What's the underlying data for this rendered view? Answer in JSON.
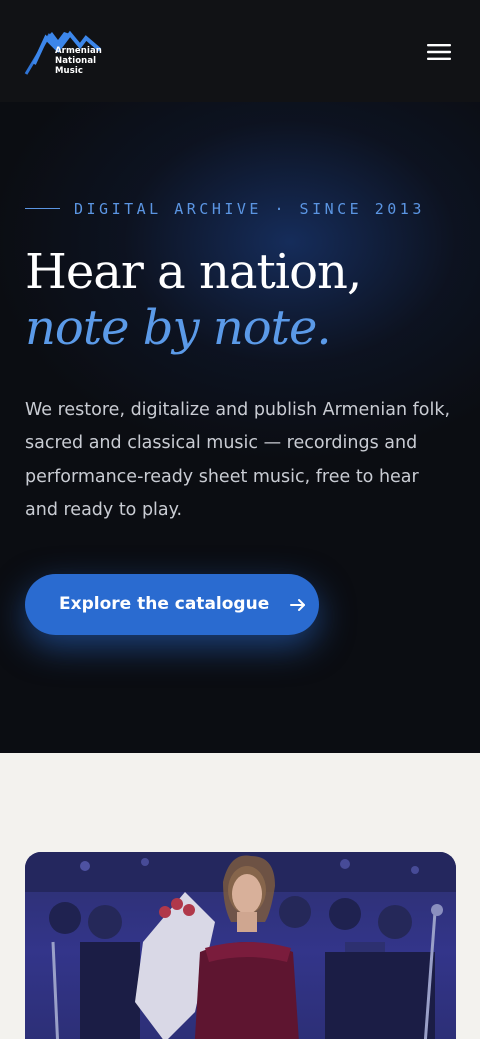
{
  "header": {
    "logo": {
      "line1": "Armenian",
      "line2": "National",
      "line3": "Music"
    },
    "menu_icon": "hamburger-menu-icon"
  },
  "hero": {
    "eyebrow": "DIGITAL ARCHIVE · SINCE 2013",
    "headline_line1": "Hear a nation,",
    "headline_line2": "note by note.",
    "intro": "We restore, digitalize and publish Armenian folk, sacred and classical music — recordings and performance-ready sheet music, free to hear and ready to play.",
    "cta_label": "Explore the catalogue",
    "cta_icon": "arrow-right-icon"
  },
  "colors": {
    "header_bg": "#111215",
    "hero_bg": "#0b0d12",
    "accent": "#5b95e2",
    "cta": "#2a6bd0",
    "light_bg": "#f3f2ee"
  }
}
